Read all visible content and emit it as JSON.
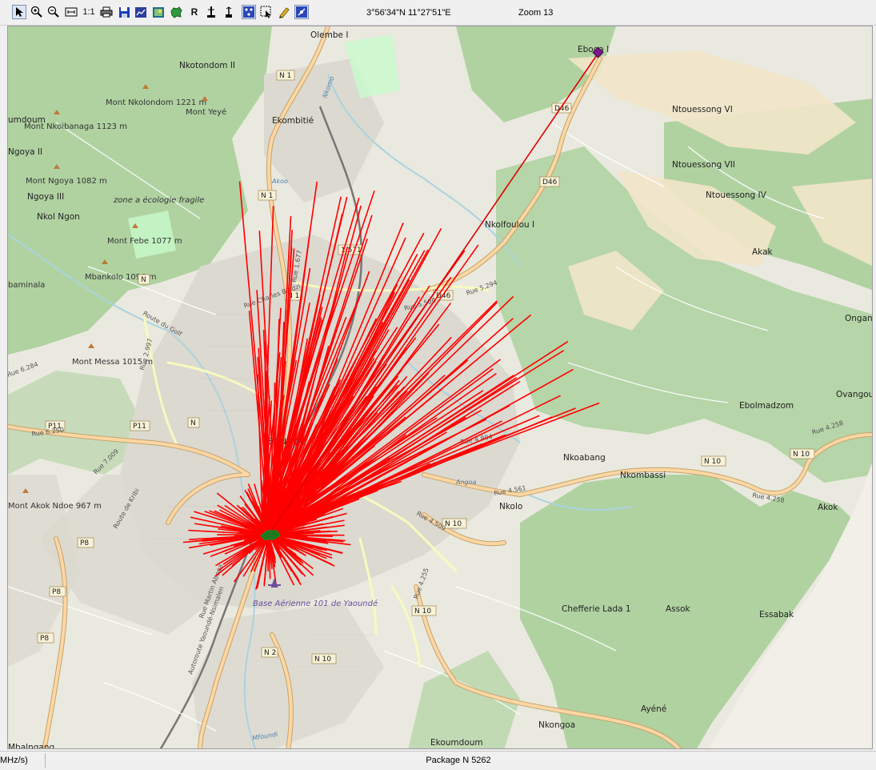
{
  "toolbar": {
    "buttons": [
      {
        "name": "select-pointer-button",
        "icon": "pointer-arrow-icon",
        "pressed": true
      },
      {
        "name": "zoom-in-button",
        "icon": "zoom-in-icon"
      },
      {
        "name": "zoom-out-button",
        "icon": "zoom-out-icon"
      },
      {
        "name": "zoom-fit-button",
        "icon": "zoom-fit-icon"
      },
      {
        "name": "zoom-actual-button",
        "icon": "one-to-one-icon",
        "label": "1:1"
      },
      {
        "name": "print-button",
        "icon": "printer-icon"
      },
      {
        "name": "save-button",
        "icon": "floppy-disk-icon"
      },
      {
        "name": "chart-button",
        "icon": "chart-window-icon"
      },
      {
        "name": "map-image-button",
        "icon": "map-image-icon"
      },
      {
        "name": "layer-region-button",
        "icon": "country-shape-icon"
      },
      {
        "name": "r-mode-button",
        "icon": "letter-r-icon",
        "label": "R"
      },
      {
        "name": "antenna-button",
        "icon": "antenna-icon"
      },
      {
        "name": "tower-button",
        "icon": "tower-icon"
      },
      {
        "name": "network-view-button",
        "icon": "network-nodes-icon",
        "pressed": true
      },
      {
        "name": "area-select-button",
        "icon": "area-select-icon"
      },
      {
        "name": "marker-tool-button",
        "icon": "pencil-icon"
      },
      {
        "name": "measure-tool-button",
        "icon": "measure-icon",
        "pressed": true
      }
    ],
    "coordinates": "3°56'34\"N 11°27'51\"E",
    "zoom_label": "Zoom 13"
  },
  "map": {
    "places": [
      "Olembe I",
      "Eboga I",
      "Nkotondom II",
      "Mont Nkolondom 1221 m",
      "Mont Yeyé",
      "Ekombitié",
      "Ntouessong VI",
      "Mont Nkoibanaga 1123 m",
      "Ntouessong VII",
      "Ntouessong IV",
      "Mont Ngoya 1082 m",
      "Ngoya III",
      "Nkol Ngon",
      "zone a écologie fragile",
      "Mont Febe 1077 m",
      "Nkolfoulou I",
      "Mbankolo 1096 m",
      "Akak",
      "Mont Messa 1015 m",
      "Ebolmadzom",
      "Ovangou",
      "Yaoundé",
      "Nkoabang",
      "Nkombassi",
      "Nkolo",
      "Akok",
      "Base Aérienne 101 de Yaoundé",
      "Chefferie Lada 1",
      "Assok",
      "Essabak",
      "Ayéné",
      "Nkongoa",
      "Ekoumdoum",
      "Mbalngang",
      "Mont Akok Ndoe 967 m",
      "Ngoya II",
      "Ongan",
      "umdoum",
      "baminala"
    ],
    "road_shields": [
      "N 1",
      "N 1",
      "N 1",
      "D46",
      "D46",
      "D46",
      "N",
      "N",
      "N 10",
      "N 10",
      "N 10",
      "N 10",
      "N 2",
      "N 10",
      "P11",
      "P11",
      "P8",
      "P8",
      "P8",
      "1.571"
    ],
    "road_names": [
      "Rue 5.500",
      "Rue 5.294",
      "Rue 4.804",
      "Rue 4.561",
      "Rue 4.509",
      "Rue 4.258",
      "Rue 4.258",
      "Rue 4.255",
      "Rue 6.250",
      "Rue 7.009",
      "Rue 6.284",
      "Rue 2.997",
      "Rue 1.677",
      "Route du Golf",
      "Route de Kribi",
      "Rue Charles Bindzi",
      "Autoroute Yaoundé-Nsimalen",
      "Rue Martin Abega",
      "Angoa",
      "Mfoundi",
      "Akoo",
      "Nkomo"
    ],
    "site_marker": "green-site-marker-icon",
    "remote_marker": "purple-diamond-marker-icon",
    "ray_color": "#ff0000"
  },
  "status": {
    "left": "MHz/s)",
    "main": "Package N 5262"
  }
}
